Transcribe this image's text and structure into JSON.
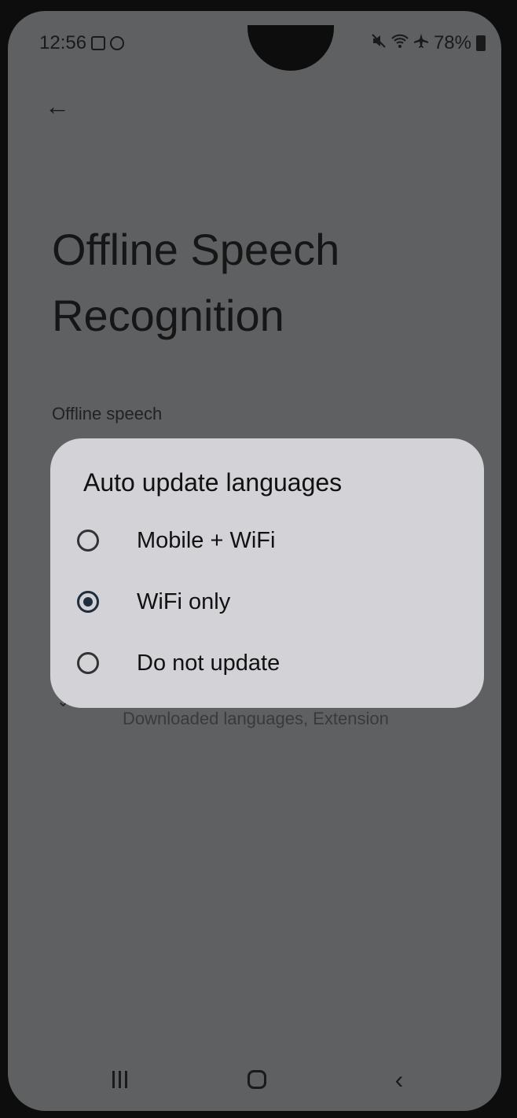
{
  "status_bar": {
    "time": "12:56",
    "battery": "78%",
    "icons": [
      "checkbox-notification-icon",
      "circle-notification-icon",
      "mute-icon",
      "wifi-icon",
      "airplane-icon",
      "battery-icon"
    ]
  },
  "toolbar": {
    "back_icon": "←"
  },
  "page": {
    "title": "Offline Speech Recognition",
    "section_label": "Offline speech",
    "chevron": "⌄",
    "under_item_subtitle": "Downloaded languages, Extension"
  },
  "dialog": {
    "title": "Auto update languages",
    "options": [
      {
        "label": "Mobile + WiFi",
        "selected": false
      },
      {
        "label": "WiFi only",
        "selected": true
      },
      {
        "label": "Do not update",
        "selected": false
      }
    ]
  },
  "nav": {
    "back_glyph": "‹"
  }
}
